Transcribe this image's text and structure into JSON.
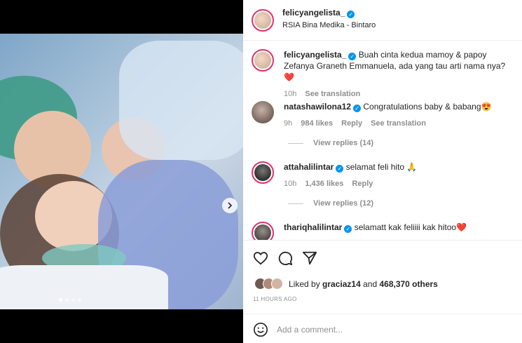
{
  "post": {
    "username": "felicyangelista_",
    "location": "RSIA Bina Medika - Bintaro"
  },
  "carousel": {
    "slide_count": 4,
    "active_index": 0
  },
  "caption": {
    "username": "felicyangelista_",
    "text": "Buah cinta kedua mamoy & papoy Zefanya Graneth Emmanuela, ada yang tau arti nama nya?❤️",
    "time": "10h",
    "see_translation": "See translation"
  },
  "comments": [
    {
      "username": "natashawilona12",
      "text": "Congratulations baby & babang😍",
      "time": "9h",
      "likes": "984 likes",
      "reply": "Reply",
      "see_translation": "See translation",
      "view_replies": "View replies (14)"
    },
    {
      "username": "attahalilintar",
      "text": "selamat feli hito 🙏",
      "time": "10h",
      "likes": "1,436 likes",
      "reply": "Reply",
      "view_replies": "View replies (12)"
    },
    {
      "username": "thariqhalilintar",
      "text": "selamatt kak feliiii kak hitoo❤️"
    }
  ],
  "likes": {
    "prefix": "Liked by",
    "user": "graciaz14",
    "middle": "and",
    "count": "468,370 others"
  },
  "timestamp": "11 HOURS AGO",
  "comment_input": {
    "placeholder": "Add a comment..."
  },
  "icons": {
    "like": "heart-icon",
    "comment": "comment-icon",
    "share": "send-icon",
    "emoji": "emoji-icon",
    "next": "chevron-right-icon",
    "verified": "verified-badge-icon"
  }
}
